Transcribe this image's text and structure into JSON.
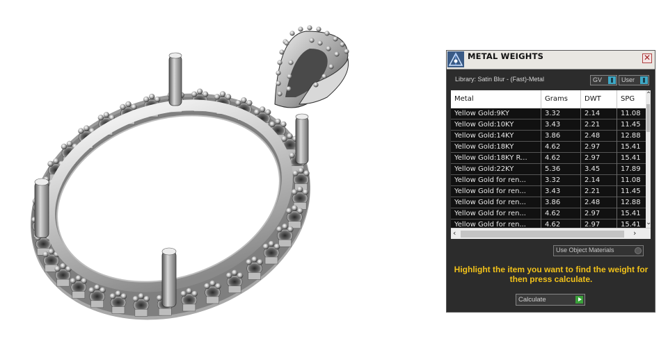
{
  "panel": {
    "title": "METAL WEIGHTS",
    "close_label": "✕",
    "library": "Library: Satin Blur - (Fast)-Metal",
    "toggles": [
      {
        "label": "GV"
      },
      {
        "label": "User"
      }
    ],
    "columns": [
      "Metal",
      "Grams",
      "DWT",
      "SPG"
    ],
    "rows": [
      [
        "Yellow Gold:9KY",
        "3.32",
        "2.14",
        "11.08"
      ],
      [
        "Yellow Gold:10KY",
        "3.43",
        "2.21",
        "11.45"
      ],
      [
        "Yellow Gold:14KY",
        "3.86",
        "2.48",
        "12.88"
      ],
      [
        "Yellow Gold:18KY",
        "4.62",
        "2.97",
        "15.41"
      ],
      [
        "Yellow Gold:18KY R...",
        "4.62",
        "2.97",
        "15.41"
      ],
      [
        "Yellow Gold:22KY",
        "5.36",
        "3.45",
        "17.89"
      ],
      [
        "Yellow Gold for ren...",
        "3.32",
        "2.14",
        "11.08"
      ],
      [
        "Yellow Gold for ren...",
        "3.43",
        "2.21",
        "11.45"
      ],
      [
        "Yellow Gold for ren...",
        "3.86",
        "2.48",
        "12.88"
      ],
      [
        "Yellow Gold for ren...",
        "4.62",
        "2.97",
        "15.41"
      ],
      [
        "Yellow Gold for ren...",
        "4.62",
        "2.97",
        "15.41"
      ]
    ],
    "use_object_materials": "Use Object Materials",
    "hint": "Highlight the item you want to find the weight for then press calculate.",
    "calculate_label": "Calculate",
    "accent_color": "#f2c21a"
  },
  "icons": {
    "app": "ruler-triangle-icon",
    "close": "close-icon",
    "scroll_up": "chevron-up-icon",
    "scroll_down": "chevron-down-icon",
    "scroll_left": "chevron-left-icon",
    "scroll_right": "chevron-right-icon"
  }
}
